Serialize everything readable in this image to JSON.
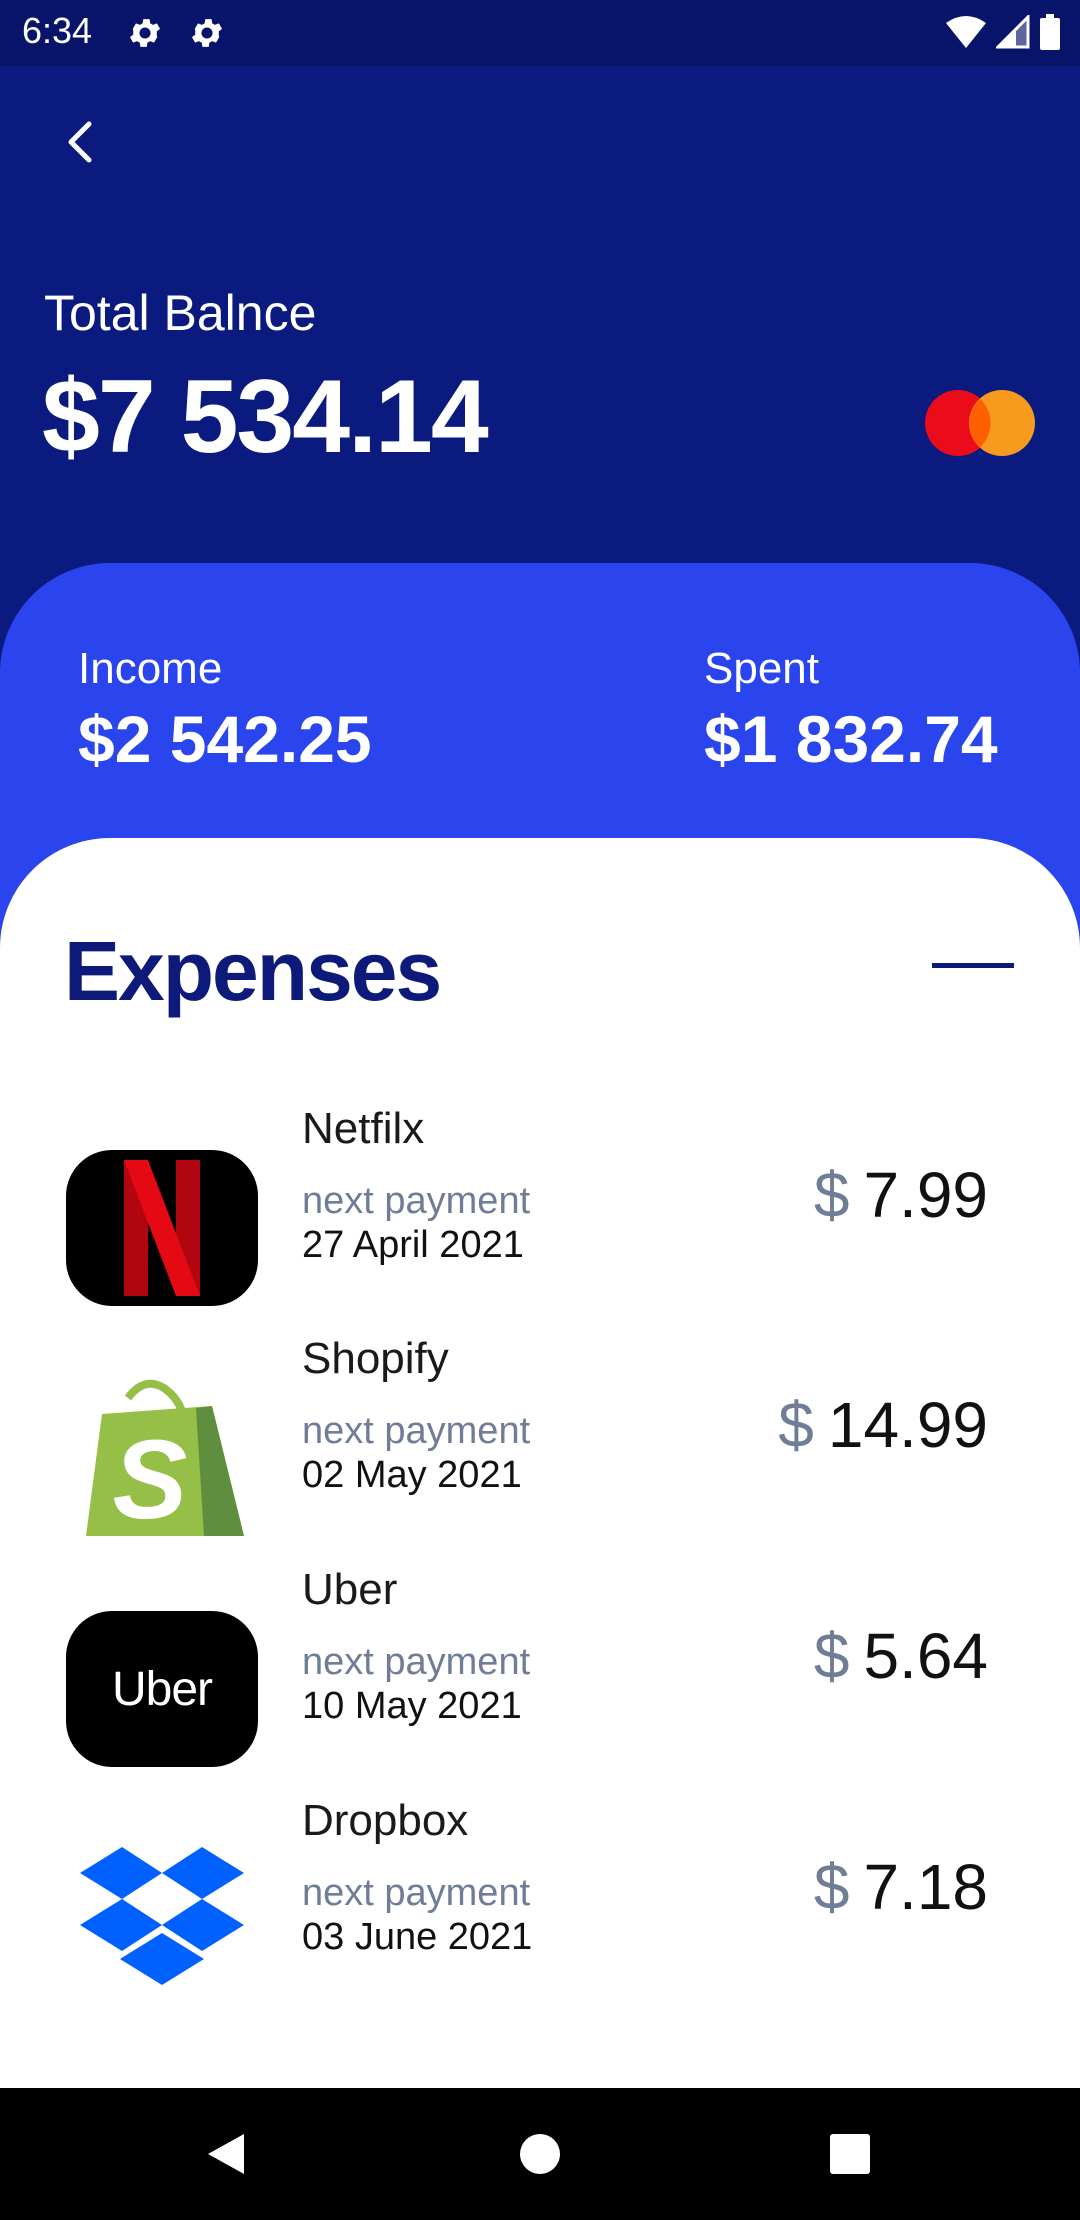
{
  "status_bar": {
    "time": "6:34",
    "icons": [
      "settings-icon",
      "settings-icon",
      "wifi-icon",
      "signal-icon",
      "battery-icon"
    ]
  },
  "header": {
    "back_icon": "chevron-left-icon",
    "balance_label": "Total Balnce",
    "balance_value": "$7 534.14",
    "card_brand_icon": "mastercard-icon"
  },
  "summary": {
    "income_label": "Income",
    "income_value": "$2 542.25",
    "spent_label": "Spent",
    "spent_value": "$1 832.74"
  },
  "expenses": {
    "title": "Expenses",
    "collapse_icon": "minus-icon",
    "items": [
      {
        "name": "Netfilx",
        "next_label": "next payment",
        "date": "27 April 2021",
        "currency": "$",
        "amount": "7.99",
        "logo": "netflix-logo"
      },
      {
        "name": "Shopify",
        "next_label": "next payment",
        "date": "02 May 2021",
        "currency": "$",
        "amount": "14.99",
        "logo": "shopify-logo"
      },
      {
        "name": "Uber",
        "next_label": "next payment",
        "date": "10 May 2021",
        "currency": "$",
        "amount": "5.64",
        "logo": "uber-logo",
        "logo_text": "Uber"
      },
      {
        "name": "Dropbox",
        "next_label": "next payment",
        "date": "03 June 2021",
        "currency": "$",
        "amount": "7.18",
        "logo": "dropbox-logo"
      }
    ]
  },
  "nav_bar": {
    "icons": [
      "back-triangle-icon",
      "home-circle-icon",
      "recents-square-icon"
    ]
  },
  "colors": {
    "header_bg": "#0a1a7e",
    "summary_bg": "#2a44ee",
    "title": "#0e1a7a",
    "muted": "#6f7d96"
  }
}
